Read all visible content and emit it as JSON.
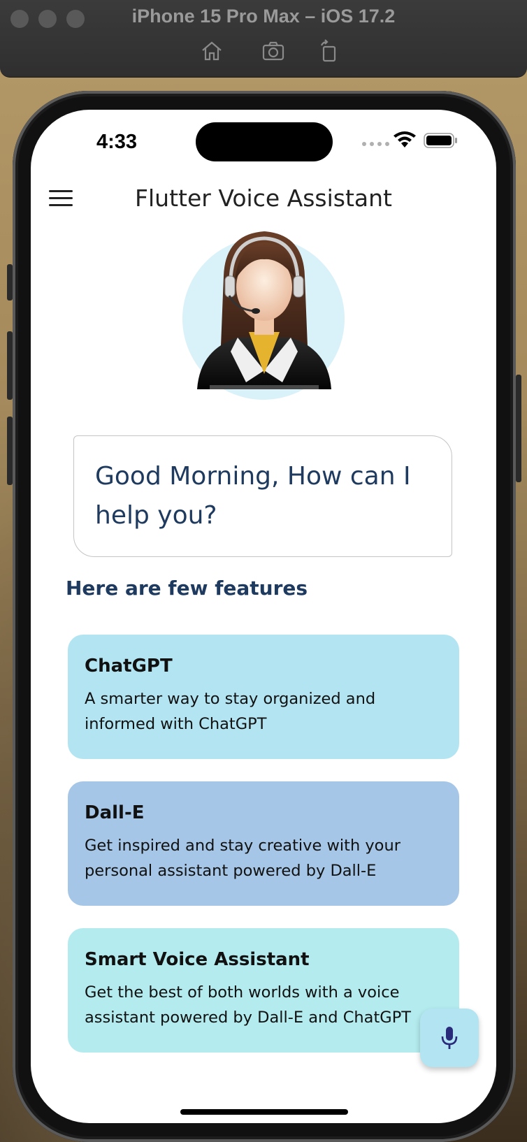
{
  "simulator": {
    "title": "iPhone 15 Pro Max – iOS 17.2",
    "toolbar_icons": [
      "home-icon",
      "screenshot-camera-icon",
      "rotate-icon"
    ]
  },
  "status_bar": {
    "time": "4:33",
    "icons": [
      "cellular-dots-icon",
      "wifi-icon",
      "battery-icon"
    ]
  },
  "app_bar": {
    "menu_icon": "hamburger-menu-icon",
    "title": "Flutter Voice Assistant"
  },
  "assistant": {
    "avatar": "assistant-avatar-icon",
    "greeting": "Good Morning, How can I help you?"
  },
  "features": {
    "heading": "Here are few features",
    "items": [
      {
        "title": "ChatGPT",
        "description": "A smarter way to stay organized and informed with ChatGPT",
        "color": "#b3e4f2"
      },
      {
        "title": "Dall-E",
        "description": "Get inspired and stay creative with your personal assistant powered by Dall-E",
        "color": "#a5c6e6"
      },
      {
        "title": "Smart Voice Assistant",
        "description": "Get the best of both worlds with a voice assistant powered by Dall-E and ChatGPT",
        "color": "#b3ebee"
      }
    ]
  },
  "mic_button": {
    "icon": "microphone-icon",
    "color": "#b3e4f2",
    "icon_color": "#2a2a7a"
  },
  "colors": {
    "heading_text": "#1e3a5f"
  }
}
